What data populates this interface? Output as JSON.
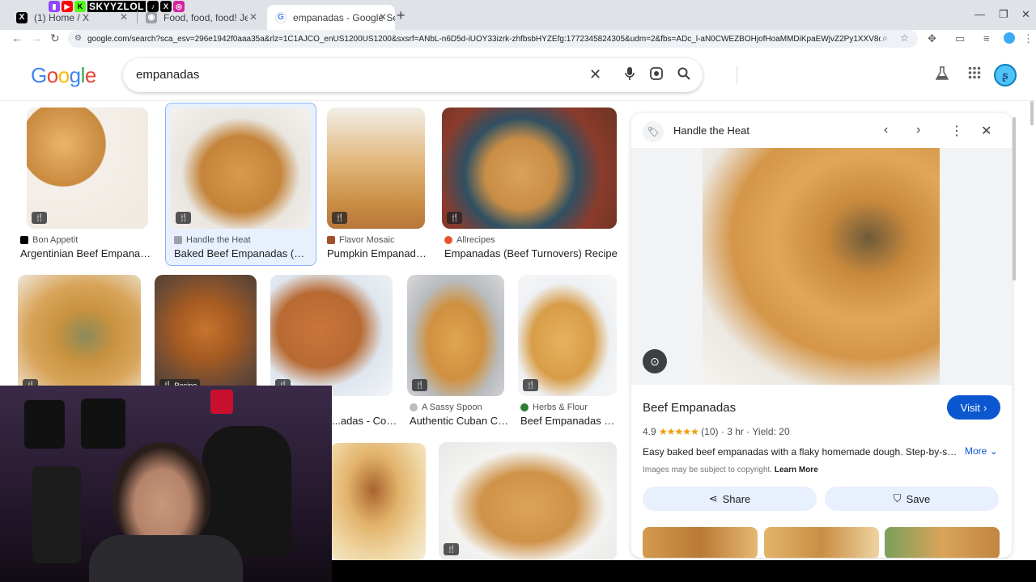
{
  "browser": {
    "tabs": [
      {
        "label": "(1) Home / X",
        "favicon": "x-logo",
        "favicon_color": "#000000"
      },
      {
        "label": "Food, food, food! Jeopardy Ter…",
        "favicon": "page-icon",
        "favicon_color": "#9aa0a6"
      },
      {
        "label": "empanadas - Google Search",
        "favicon": "google-g",
        "favicon_color": "#4285f4",
        "active": true
      }
    ],
    "new_tab": "+",
    "url": "google.com/search?sca_esv=296e1942f0aaa35a&rlz=1C1AJCO_enUS1200US1200&sxsrf=ANbL-n6D5d-iUOY33izrk-zhfbsbHYZEfg:1772345824305&udm=2&fbs=ADc_l-aN0CWEZBOHjofHoaMMDiKpaEWjvZ2Py1XXV8d8KvlI3o6iwGk6lv1...",
    "overlay_label": "SKYYZLOL"
  },
  "google": {
    "logo": "Google",
    "logo_colors": [
      "#4285f4",
      "#ea4335",
      "#fbbc05",
      "#4285f4",
      "#34a853",
      "#ea4335"
    ],
    "query": "empanadas",
    "icons": [
      "clear-icon",
      "mic-icon",
      "lens-icon",
      "search-icon",
      "labs-icon",
      "apps-icon"
    ]
  },
  "results": [
    {
      "source": "Bon Appetit",
      "title": "Argentinian Beef Empanadas ...",
      "source_color": "#000000"
    },
    {
      "source": "Handle the Heat",
      "title": "Baked Beef Empanadas (Eas...",
      "source_color": "#9aa0a6",
      "selected": true
    },
    {
      "source": "Flavor Mosaic",
      "title": "Pumpkin Empanadas...",
      "source_color": "#a0522d"
    },
    {
      "source": "Allrecipes",
      "title": "Empanadas (Beef Turnovers) Recipe",
      "source_color": "#e8552d"
    },
    {
      "source": "",
      "title": "...adas - Coo...",
      "source_color": "#9aa0a6",
      "partial": true
    },
    {
      "source": "A Sassy Spoon",
      "title": "Authentic Cuban Ch...",
      "source_color": "#bdbdbd"
    },
    {
      "source": "Herbs & Flour",
      "title": "Beef Empanadas - ...",
      "source_color": "#2e7d32"
    }
  ],
  "badges": {
    "recipe": "Recipe"
  },
  "panel": {
    "source": "Handle the Heat",
    "title": "Beef Empanadas",
    "visit": "Visit",
    "rating": "4.9",
    "stars": "★★★★★",
    "reviews": "(10)",
    "time": "3 hr",
    "yield": "Yield: 20",
    "description": "Easy baked beef empanadas with a flaky homemade dough. Step-by-step...",
    "more": "More",
    "copyright": "Images may be subject to copyright.",
    "learn_more": "Learn More",
    "share": "Share",
    "save": "Save"
  }
}
